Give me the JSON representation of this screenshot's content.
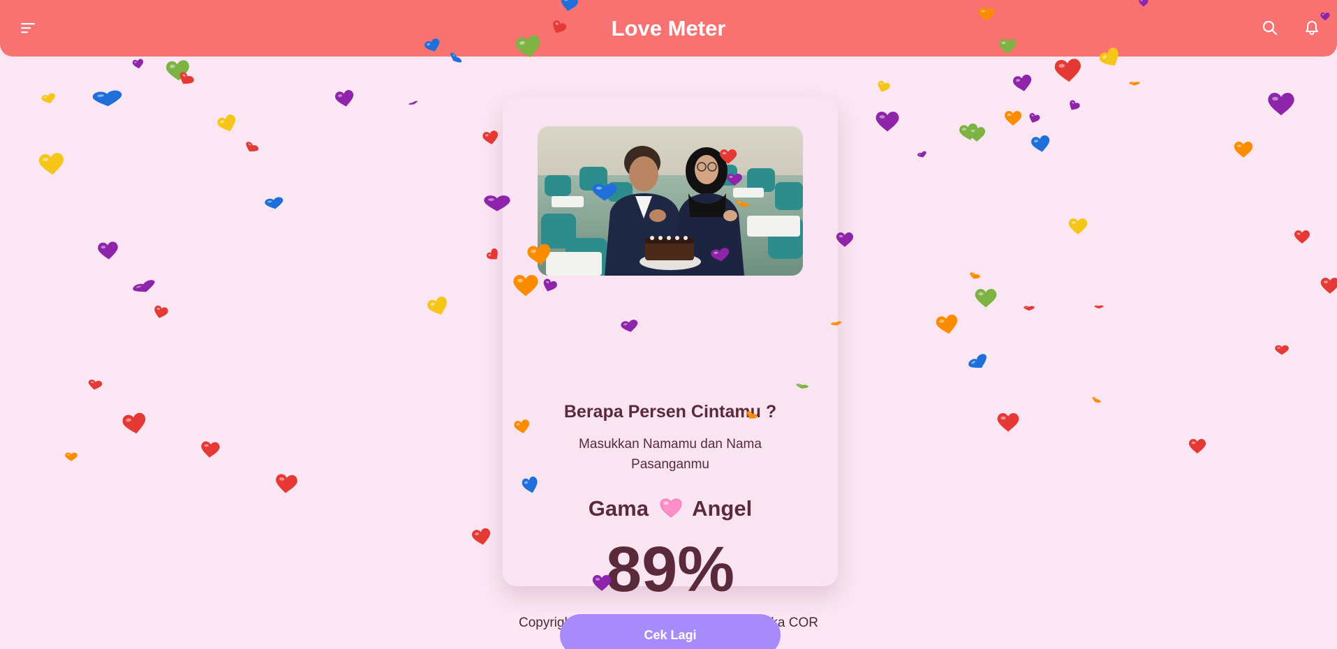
{
  "header": {
    "title": "Love Meter",
    "menu_icon": "menu-icon",
    "search_icon": "search-icon",
    "bell_icon": "bell-icon"
  },
  "card": {
    "title": "Berapa Persen Cintamu ?",
    "subtitle": "Masukkan Namamu dan Nama Pasanganmu",
    "name_1": "Gama",
    "name_2": "Angel",
    "separator_icon": "pink-heart-icon",
    "percent": "89%",
    "button_label": "Cek Lagi"
  },
  "footer": {
    "text": "Copyright © 2024 - All right reserved by Raka COR"
  },
  "colors": {
    "topbar": "#f87272",
    "background": "#fbe6f3",
    "card": "#f9e4f1",
    "text": "#5a2a3a",
    "button": "#a78bfa",
    "confetti": [
      "#e53935",
      "#8e24aa",
      "#1e6fd9",
      "#f5c518",
      "#fb8c00",
      "#7cb342"
    ]
  }
}
